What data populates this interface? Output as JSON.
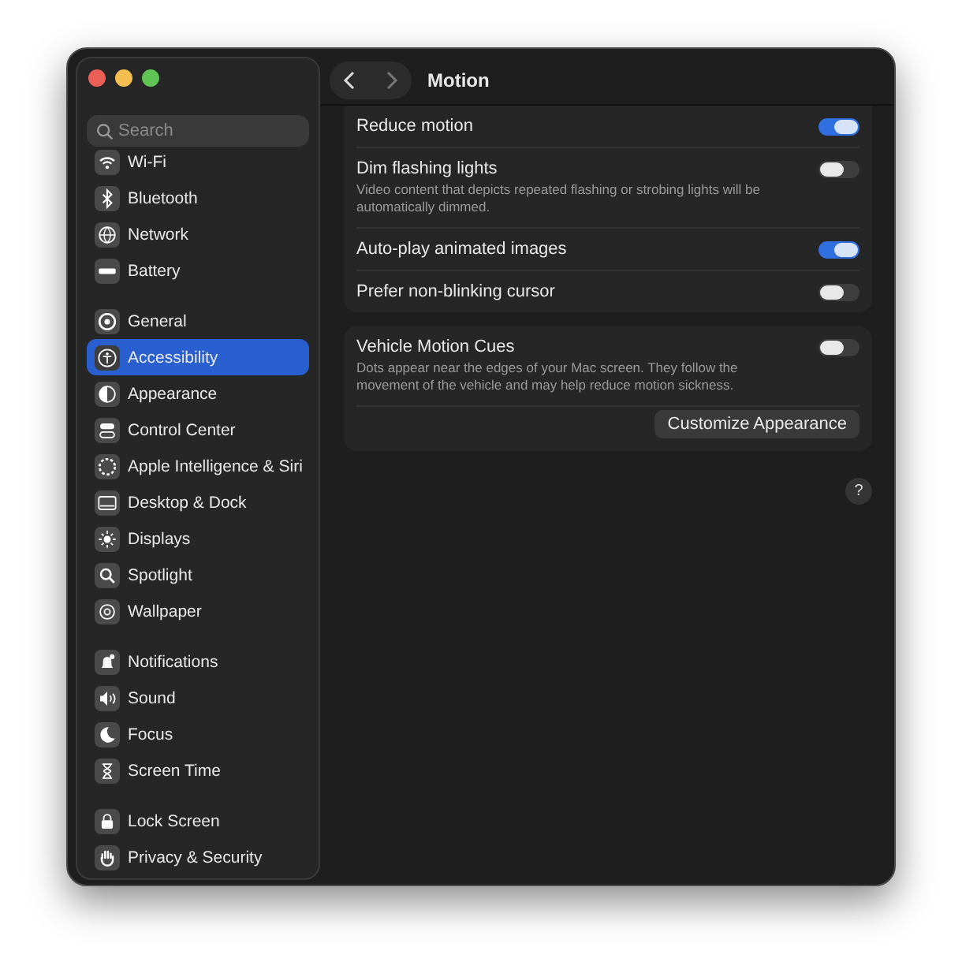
{
  "window": {
    "title": "Motion"
  },
  "search": {
    "placeholder": "Search"
  },
  "sidebar": {
    "groups": [
      {
        "items": [
          {
            "label": "Wi-Fi",
            "selected": false
          },
          {
            "label": "Bluetooth",
            "selected": false
          },
          {
            "label": "Network",
            "selected": false
          },
          {
            "label": "Battery",
            "selected": false
          }
        ]
      },
      {
        "items": [
          {
            "label": "General",
            "selected": false
          },
          {
            "label": "Accessibility",
            "selected": true
          },
          {
            "label": "Appearance",
            "selected": false
          },
          {
            "label": "Control Center",
            "selected": false
          },
          {
            "label": "Apple Intelligence & Siri",
            "selected": false
          },
          {
            "label": "Desktop & Dock",
            "selected": false
          },
          {
            "label": "Displays",
            "selected": false
          },
          {
            "label": "Spotlight",
            "selected": false
          },
          {
            "label": "Wallpaper",
            "selected": false
          }
        ]
      },
      {
        "items": [
          {
            "label": "Notifications",
            "selected": false
          },
          {
            "label": "Sound",
            "selected": false
          },
          {
            "label": "Focus",
            "selected": false
          },
          {
            "label": "Screen Time",
            "selected": false
          }
        ]
      },
      {
        "items": [
          {
            "label": "Lock Screen",
            "selected": false
          },
          {
            "label": "Privacy & Security",
            "selected": false
          }
        ]
      }
    ]
  },
  "sections": [
    {
      "rows": [
        {
          "label": "Reduce motion",
          "on": true
        },
        {
          "label": "Dim flashing lights",
          "description": "Video content that depicts repeated flashing or strobing lights will be automatically dimmed.",
          "on": false
        },
        {
          "label": "Auto-play animated images",
          "on": true
        },
        {
          "label": "Prefer non-blinking cursor",
          "on": false
        }
      ]
    },
    {
      "rows": [
        {
          "label": "Vehicle Motion Cues",
          "description": "Dots appear near the edges of your Mac screen. They follow the movement of the vehicle and may help reduce motion sickness.",
          "on": false
        }
      ],
      "button": "Customize Appearance"
    }
  ],
  "help": "?"
}
